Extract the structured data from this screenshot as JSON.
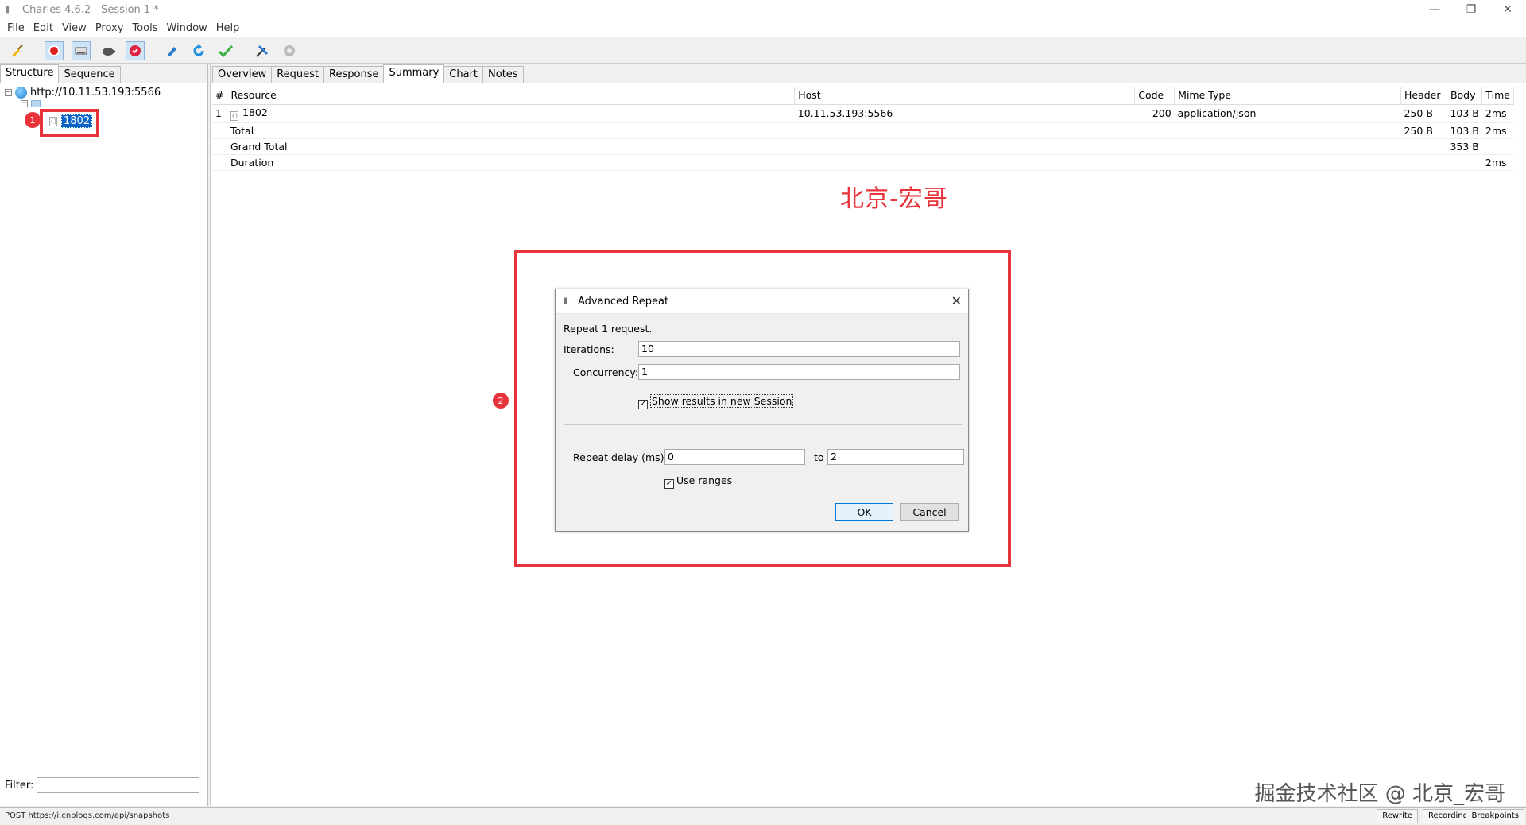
{
  "window": {
    "title": "Charles 4.6.2 - Session 1 *"
  },
  "menu": [
    "File",
    "Edit",
    "View",
    "Proxy",
    "Tools",
    "Window",
    "Help"
  ],
  "left": {
    "tabs": [
      "Structure",
      "Sequence"
    ],
    "host": "http://10.11.53.193:5566",
    "selected_item": "1802",
    "filter_label": "Filter:"
  },
  "right": {
    "tabs": [
      "Overview",
      "Request",
      "Response",
      "Summary",
      "Chart",
      "Notes"
    ],
    "active_tab": "Summary",
    "columns": [
      "#",
      "Resource",
      "Host",
      "Code",
      "Mime Type",
      "Header",
      "Body",
      "Time"
    ],
    "rows": [
      {
        "num": "1",
        "resource": "1802",
        "host": "10.11.53.193:5566",
        "code": "200",
        "mime": "application/json",
        "header": "250 B",
        "body": "103 B",
        "time": "2ms"
      },
      {
        "num": "",
        "resource": "Total",
        "host": "",
        "code": "",
        "mime": "",
        "header": "250 B",
        "body": "103 B",
        "time": "2ms"
      },
      {
        "num": "",
        "resource": "Grand Total",
        "host": "",
        "code": "",
        "mime": "",
        "header": "",
        "body": "353 B",
        "time": ""
      },
      {
        "num": "",
        "resource": "Duration",
        "host": "",
        "code": "",
        "mime": "",
        "header": "",
        "body": "",
        "time": "2ms"
      }
    ]
  },
  "watermark_top": "北京-宏哥",
  "watermark_bottom": "掘金技术社区 @ 北京_宏哥",
  "markers": [
    "1",
    "2"
  ],
  "dialog": {
    "title": "Advanced Repeat",
    "intro": "Repeat 1 request.",
    "iterations_label": "Iterations:",
    "iterations_value": "10",
    "concurrency_label": "Concurrency:",
    "concurrency_value": "1",
    "show_results_label": "Show results in new Session",
    "show_results_checked": true,
    "repeat_delay_label": "Repeat delay (ms):",
    "repeat_delay_from": "0",
    "to_label": "to",
    "repeat_delay_to": "2",
    "use_ranges_label": "Use ranges",
    "use_ranges_checked": true,
    "ok_label": "OK",
    "cancel_label": "Cancel"
  },
  "status": {
    "text": "POST https://i.cnblogs.com/api/snapshots",
    "buttons": [
      "Rewrite",
      "Recording",
      "Breakpoints"
    ]
  },
  "colors": {
    "annotation_red": "#e8333a",
    "selection_blue": "#0a64c8"
  }
}
